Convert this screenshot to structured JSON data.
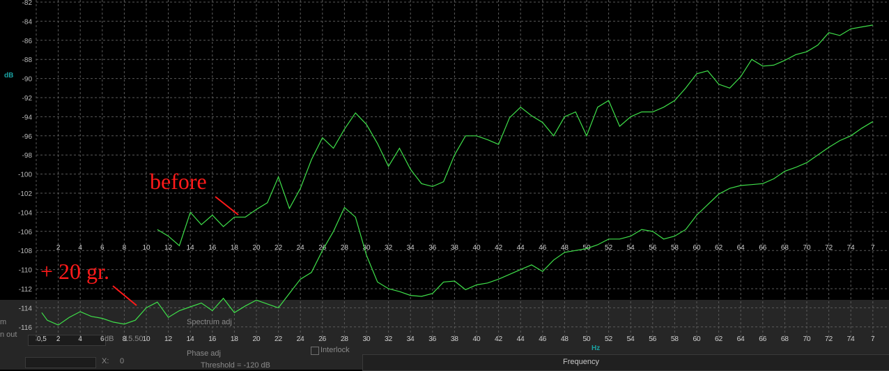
{
  "chart_data": {
    "type": "line",
    "ylabel": "dB",
    "xlabel": "Hz",
    "x_axis_caption": "Frequency",
    "ylim": [
      -117,
      -82
    ],
    "xlim": [
      0,
      76
    ],
    "yticks": [
      "-82",
      "-84",
      "-86",
      "-88",
      "-90",
      "-92",
      "-94",
      "-96",
      "-98",
      "-100",
      "-102",
      "-104",
      "-106",
      "-108",
      "-110",
      "-112",
      "-114",
      "-116"
    ],
    "xticks_mid": [
      "2",
      "4",
      "6",
      "8",
      "10",
      "12",
      "14",
      "16",
      "18",
      "20",
      "22",
      "24",
      "26",
      "28",
      "30",
      "32",
      "34",
      "36",
      "38",
      "40",
      "42",
      "44",
      "46",
      "48",
      "50",
      "52",
      "54",
      "56",
      "58",
      "60",
      "62",
      "64",
      "66",
      "68",
      "70",
      "72",
      "74",
      "7"
    ],
    "xticks_bottom": [
      "0,5",
      "2",
      "4",
      "6",
      "8",
      "10",
      "12",
      "14",
      "16",
      "18",
      "20",
      "22",
      "24",
      "26",
      "28",
      "30",
      "32",
      "34",
      "36",
      "38",
      "40",
      "42",
      "44",
      "46",
      "48",
      "50",
      "52",
      "54",
      "56",
      "58",
      "60",
      "62",
      "64",
      "66",
      "68",
      "70",
      "72",
      "74",
      "7"
    ],
    "grid": true,
    "line_color": "#3fe04a",
    "series": [
      {
        "x": [
          11,
          12,
          13,
          14,
          15,
          16,
          17,
          18,
          19,
          20,
          21,
          22,
          23,
          24,
          25,
          26,
          27,
          28,
          29,
          30,
          31,
          32,
          33,
          34,
          35,
          36,
          37,
          38,
          39,
          40,
          41,
          42,
          43,
          44,
          45,
          46,
          47,
          48,
          49,
          50,
          51,
          52,
          53,
          54,
          55,
          56,
          57,
          58,
          59,
          60,
          61,
          62,
          63,
          64,
          65,
          66,
          67,
          68,
          69,
          70,
          71,
          72,
          73,
          74,
          75,
          76
        ],
        "values": [
          -105.8,
          -106.5,
          -107.5,
          -104,
          -105.3,
          -104.3,
          -105.5,
          -104.5,
          -104.5,
          -103.7,
          -103,
          -100.3,
          -103.6,
          -101.5,
          -98.5,
          -96.2,
          -97.3,
          -95.3,
          -93.6,
          -94.8,
          -96.8,
          -99.2,
          -97.3,
          -99.5,
          -101,
          -101.3,
          -100.8,
          -98,
          -96,
          -96,
          -96.4,
          -96.9,
          -94.1,
          -93,
          -93.9,
          -94.6,
          -96,
          -94,
          -93.5,
          -96,
          -93,
          -92.3,
          -95,
          -94,
          -93.5,
          -93.5,
          -93,
          -92.3,
          -91,
          -89.5,
          -89.2,
          -90.6,
          -91,
          -89.8,
          -88,
          -88.7,
          -88.6,
          -88.1,
          -87.5,
          -87.2,
          -86.5,
          -85.2,
          -85.5,
          -84.8,
          -84.6,
          -84.4
        ]
      },
      {
        "x": [
          0.5,
          1,
          2,
          3,
          4,
          5,
          6,
          7,
          8,
          9,
          10,
          11,
          12,
          13,
          14,
          15,
          16,
          17,
          18,
          19,
          20,
          21,
          22,
          23,
          24,
          25,
          26,
          27,
          28,
          29,
          30,
          31,
          32,
          33,
          34,
          35,
          36,
          37,
          38,
          39,
          40,
          41,
          42,
          43,
          44,
          45,
          46,
          47,
          48,
          49,
          50,
          51,
          52,
          53,
          54,
          55,
          56,
          57,
          58,
          59,
          60,
          61,
          62,
          63,
          64,
          65,
          66,
          67,
          68,
          69,
          70,
          71,
          72,
          73,
          74,
          75,
          76
        ],
        "values": [
          -114.5,
          -115.3,
          -115.8,
          -115,
          -114.4,
          -114.9,
          -115.1,
          -115.5,
          -115.7,
          -115.3,
          -114,
          -113.4,
          -115,
          -114.3,
          -113.9,
          -113.5,
          -114.3,
          -113,
          -114.5,
          -113.8,
          -113.2,
          -113.6,
          -114,
          -112.5,
          -111,
          -110.3,
          -108,
          -106,
          -103.5,
          -104.5,
          -108.5,
          -111.3,
          -112,
          -112.3,
          -112.7,
          -112.8,
          -112.5,
          -111.3,
          -111.2,
          -112.1,
          -111.6,
          -111.4,
          -111,
          -110.5,
          -110,
          -109.5,
          -110.2,
          -109,
          -108.2,
          -108,
          -107.8,
          -107.4,
          -106.8,
          -106.8,
          -106.5,
          -105.8,
          -106,
          -106.8,
          -106.5,
          -105.8,
          -104.3,
          -103.2,
          -102.1,
          -101.5,
          -101.2,
          -101.1,
          -101,
          -100.5,
          -99.7,
          -99.3,
          -98.8,
          -98,
          -97.2,
          -96.5,
          -96,
          -95.2,
          -94.5
        ]
      }
    ],
    "annotations": [
      {
        "text": "before",
        "color": "#ff1a1a"
      },
      {
        "text": "+ 20 gr.",
        "color": "#ff1a1a"
      }
    ]
  },
  "panel": {
    "left_labels": [
      "m",
      "n out"
    ],
    "spectrum_adj": "Spectrum adj",
    "phase_adj": "Phase adj",
    "threshold": "Threshold = -120 dB",
    "interlock": "Interlock",
    "x_coord_label": "X:",
    "x_coord_value": "0",
    "field_a": "dB",
    "field_b": "15.50"
  }
}
